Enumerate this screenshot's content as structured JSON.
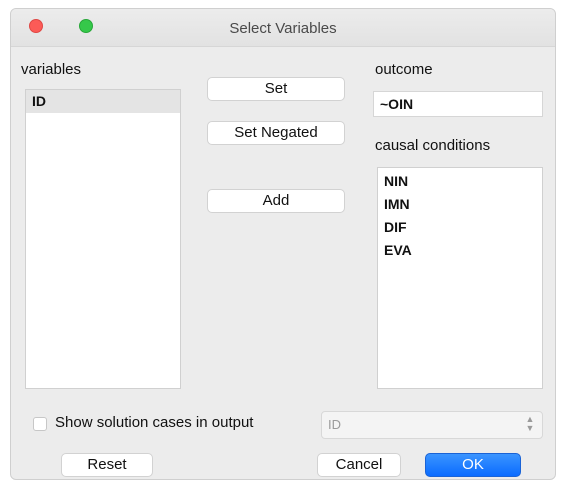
{
  "window": {
    "title": "Select Variables"
  },
  "variables": {
    "label": "variables",
    "items": [
      "ID"
    ]
  },
  "buttons": {
    "set": "Set",
    "set_negated": "Set Negated",
    "add": "Add",
    "reset": "Reset",
    "cancel": "Cancel",
    "ok": "OK"
  },
  "outcome": {
    "label": "outcome",
    "value": "~OIN"
  },
  "causal_conditions": {
    "label": "causal conditions",
    "items": [
      "NIN",
      "IMN",
      "DIF",
      "EVA"
    ]
  },
  "solution_cases": {
    "label": "Show solution cases in output",
    "checked": false,
    "select_value": "ID"
  },
  "colors": {
    "accent": "#0a6bff",
    "close": "#fc5b57",
    "zoom": "#35c84a"
  }
}
